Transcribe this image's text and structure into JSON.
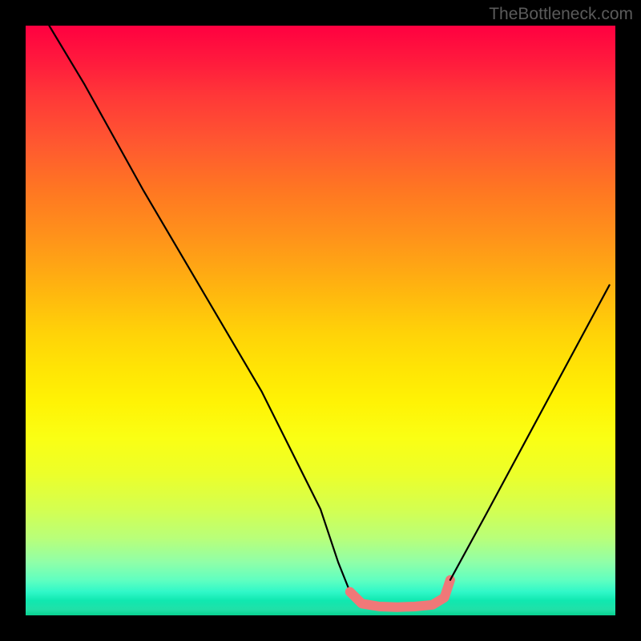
{
  "watermark": "TheBottleneck.com",
  "chart_data": {
    "type": "line",
    "title": "",
    "xlabel": "",
    "ylabel": "",
    "xlim": [
      0,
      100
    ],
    "ylim": [
      0,
      100
    ],
    "series": [
      {
        "name": "black-curve-left",
        "color": "#000000",
        "x": [
          4,
          10,
          20,
          30,
          40,
          50,
          53,
          55
        ],
        "y": [
          100,
          90,
          72,
          55,
          38,
          18,
          9,
          4
        ]
      },
      {
        "name": "pink-flat-segment",
        "color": "#f07878",
        "x": [
          55,
          57,
          60,
          63,
          66,
          69,
          71,
          72
        ],
        "y": [
          4,
          2,
          1.5,
          1.4,
          1.5,
          1.8,
          3,
          6
        ]
      },
      {
        "name": "black-curve-right",
        "color": "#000000",
        "x": [
          72,
          78,
          85,
          92,
          99
        ],
        "y": [
          6,
          17,
          30,
          43,
          56
        ]
      }
    ]
  },
  "colors": {
    "black": "#000000",
    "pink": "#f07878"
  }
}
